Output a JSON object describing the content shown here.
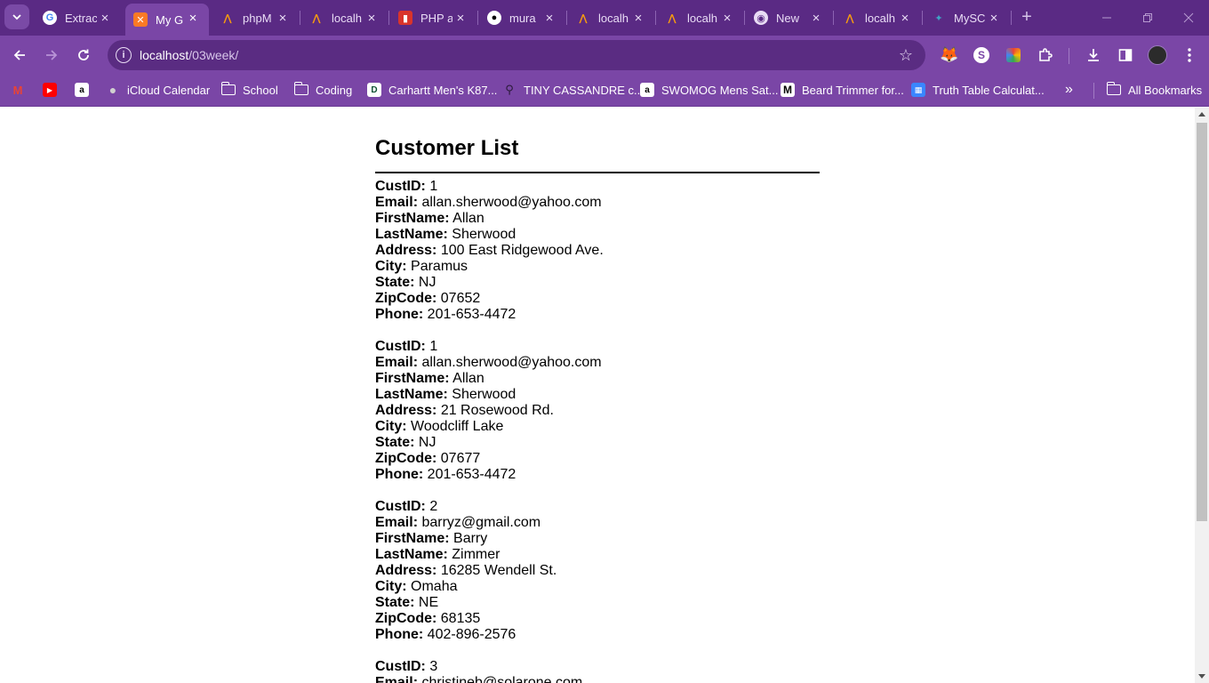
{
  "browser": {
    "tabs": [
      {
        "label": "Extrac",
        "icon": "google-icon"
      },
      {
        "label": "My G",
        "icon": "xampp-icon",
        "active": true
      },
      {
        "label": "phpM",
        "icon": "phpmyadmin-icon"
      },
      {
        "label": "localh",
        "icon": "phpmyadmin-icon"
      },
      {
        "label": "PHP a",
        "icon": "php-book-icon"
      },
      {
        "label": "mura",
        "icon": "github-icon"
      },
      {
        "label": "localh",
        "icon": "phpmyadmin-icon"
      },
      {
        "label": "localh",
        "icon": "phpmyadmin-icon"
      },
      {
        "label": "New",
        "icon": "chrome-icon"
      },
      {
        "label": "localh",
        "icon": "phpmyadmin-icon"
      },
      {
        "label": "MySC",
        "icon": "mysql-icon"
      }
    ],
    "address": {
      "host": "localhost",
      "path": "/03week/"
    },
    "bookmarks": [
      {
        "label": "",
        "icon": "gmail-icon"
      },
      {
        "label": "",
        "icon": "youtube-icon"
      },
      {
        "label": "",
        "icon": "amazon-icon"
      },
      {
        "label": "iCloud Calendar",
        "icon": "apple-icon"
      },
      {
        "label": "School",
        "icon": "folder-icon"
      },
      {
        "label": "Coding",
        "icon": "folder-icon"
      },
      {
        "label": "Carhartt Men's K87...",
        "icon": "carhartt-icon"
      },
      {
        "label": "TINY CASSANDRE c...",
        "icon": "figure-icon"
      },
      {
        "label": "SWOMOG Mens Sat...",
        "icon": "amazon-icon"
      },
      {
        "label": "Beard Trimmer for...",
        "icon": "m-icon"
      },
      {
        "label": "Truth Table Calculat...",
        "icon": "calculator-icon"
      }
    ],
    "overflow_label": "»",
    "all_bookmarks_label": "All Bookmarks",
    "colors": {
      "tabstrip": "#5a2a84",
      "toolbar": "#7a46a6",
      "omnibox": "#5a2c82"
    }
  },
  "page": {
    "title": "Customer List",
    "records": [
      {
        "fields": [
          {
            "key": "CustID:",
            "value": "1"
          },
          {
            "key": "Email:",
            "value": "allan.sherwood@yahoo.com"
          },
          {
            "key": "FirstName:",
            "value": "Allan"
          },
          {
            "key": "LastName:",
            "value": "Sherwood"
          },
          {
            "key": "Address:",
            "value": "100 East Ridgewood Ave."
          },
          {
            "key": "City:",
            "value": "Paramus"
          },
          {
            "key": "State:",
            "value": "NJ"
          },
          {
            "key": "ZipCode:",
            "value": "07652"
          },
          {
            "key": "Phone:",
            "value": "201-653-4472"
          }
        ]
      },
      {
        "fields": [
          {
            "key": "CustID:",
            "value": "1"
          },
          {
            "key": "Email:",
            "value": "allan.sherwood@yahoo.com"
          },
          {
            "key": "FirstName:",
            "value": "Allan"
          },
          {
            "key": "LastName:",
            "value": "Sherwood"
          },
          {
            "key": "Address:",
            "value": "21 Rosewood Rd."
          },
          {
            "key": "City:",
            "value": "Woodcliff Lake"
          },
          {
            "key": "State:",
            "value": "NJ"
          },
          {
            "key": "ZipCode:",
            "value": "07677"
          },
          {
            "key": "Phone:",
            "value": "201-653-4472"
          }
        ]
      },
      {
        "fields": [
          {
            "key": "CustID:",
            "value": "2"
          },
          {
            "key": "Email:",
            "value": "barryz@gmail.com"
          },
          {
            "key": "FirstName:",
            "value": "Barry"
          },
          {
            "key": "LastName:",
            "value": "Zimmer"
          },
          {
            "key": "Address:",
            "value": "16285 Wendell St."
          },
          {
            "key": "City:",
            "value": "Omaha"
          },
          {
            "key": "State:",
            "value": "NE"
          },
          {
            "key": "ZipCode:",
            "value": "68135"
          },
          {
            "key": "Phone:",
            "value": "402-896-2576"
          }
        ]
      },
      {
        "fields": [
          {
            "key": "CustID:",
            "value": "3"
          },
          {
            "key": "Email:",
            "value": "christineb@solarone.com"
          }
        ]
      }
    ]
  }
}
